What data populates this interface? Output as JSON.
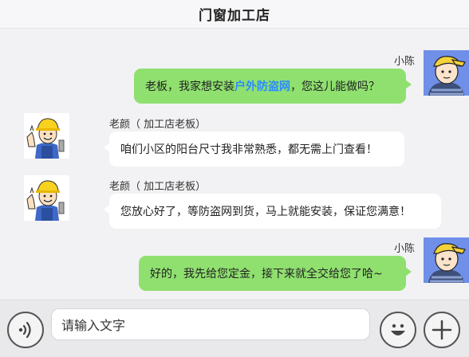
{
  "header": {
    "title": "门窗加工店"
  },
  "messages": [
    {
      "side": "right",
      "sender": "小陈",
      "text_before": "老板，我家想安装",
      "text_highlight": "户外防盗网",
      "text_after": "，您这儿能做吗？"
    },
    {
      "side": "left",
      "sender": "老颜（ 加工店老板）",
      "text": "咱们小区的阳台尺寸我非常熟悉，都无需上门查看！"
    },
    {
      "side": "left",
      "sender": "老颜（ 加工店老板）",
      "text": "您放心好了，等防盗网到货，马上就能安装，保证您满意！"
    },
    {
      "side": "right",
      "sender": "小陈",
      "text": "好的，我先给您定金，接下来就全交给您了哈~"
    }
  ],
  "input": {
    "placeholder": "请输入文字"
  },
  "icons": {
    "voice": "voice-icon",
    "emoji": "emoji-icon",
    "plus": "plus-icon"
  },
  "colors": {
    "bubble_right": "#8fe06f",
    "bubble_left": "#ffffff",
    "highlight": "#2a8bff",
    "background": "#f2f2f4"
  }
}
